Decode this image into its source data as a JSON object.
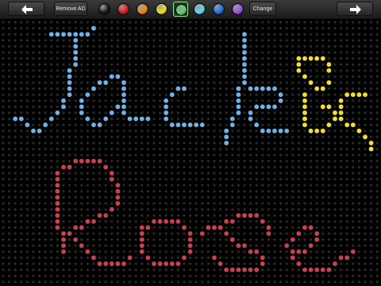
{
  "toolbar": {
    "back_label": "",
    "remove_ad_label": "Remove AD",
    "change_label": "Change",
    "forward_label": ""
  },
  "palette": {
    "colors": [
      "#1a1a1a",
      "#e21b1b",
      "#f08a0c",
      "#f3e21a",
      "#5dd06a",
      "#63d7f0",
      "#1f6fe0",
      "#9b4fe0"
    ],
    "selected_index": 4
  },
  "board": {
    "background": "#000000",
    "empty_peg_color": "#2a2a2a",
    "peg_colors": {
      "blue": "#6fb3e8",
      "yellow": "#f2df2e",
      "red": "#c8434f"
    },
    "drawn_text": {
      "line1": "Jacob",
      "line2": "Rose"
    }
  }
}
